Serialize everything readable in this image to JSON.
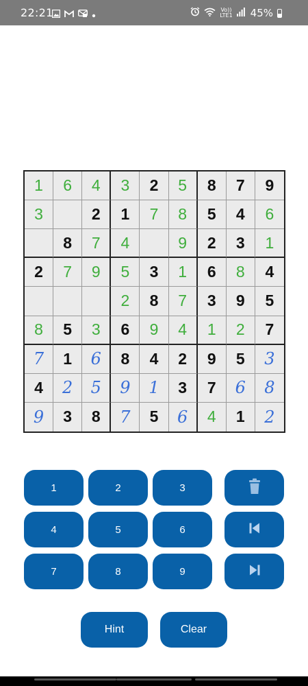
{
  "status_bar": {
    "time": "22:21",
    "battery": "45%",
    "volte_top": "Vo))",
    "volte_bottom": "LTE1",
    "notification_icons": [
      "gallery-icon",
      "gmail-icon",
      "message-icon",
      "dot-icon"
    ],
    "system_icons": [
      "alarm-icon",
      "wifi-icon",
      "volte-icon",
      "signal-icon",
      "battery-icon"
    ]
  },
  "board": {
    "rows": [
      [
        {
          "v": "1",
          "t": "solved"
        },
        {
          "v": "6",
          "t": "solved"
        },
        {
          "v": "4",
          "t": "solved"
        },
        {
          "v": "3",
          "t": "solved"
        },
        {
          "v": "2",
          "t": "given"
        },
        {
          "v": "5",
          "t": "solved"
        },
        {
          "v": "8",
          "t": "given"
        },
        {
          "v": "7",
          "t": "given"
        },
        {
          "v": "9",
          "t": "given"
        }
      ],
      [
        {
          "v": "3",
          "t": "solved"
        },
        {
          "v": "",
          "t": "empty"
        },
        {
          "v": "2",
          "t": "given"
        },
        {
          "v": "1",
          "t": "given"
        },
        {
          "v": "7",
          "t": "solved"
        },
        {
          "v": "8",
          "t": "solved"
        },
        {
          "v": "5",
          "t": "given"
        },
        {
          "v": "4",
          "t": "given"
        },
        {
          "v": "6",
          "t": "solved"
        }
      ],
      [
        {
          "v": "",
          "t": "empty"
        },
        {
          "v": "8",
          "t": "given"
        },
        {
          "v": "7",
          "t": "solved"
        },
        {
          "v": "4",
          "t": "solved"
        },
        {
          "v": "",
          "t": "empty"
        },
        {
          "v": "9",
          "t": "solved"
        },
        {
          "v": "2",
          "t": "given"
        },
        {
          "v": "3",
          "t": "given"
        },
        {
          "v": "1",
          "t": "solved"
        }
      ],
      [
        {
          "v": "2",
          "t": "given"
        },
        {
          "v": "7",
          "t": "solved"
        },
        {
          "v": "9",
          "t": "solved"
        },
        {
          "v": "5",
          "t": "solved"
        },
        {
          "v": "3",
          "t": "given"
        },
        {
          "v": "1",
          "t": "solved"
        },
        {
          "v": "6",
          "t": "given"
        },
        {
          "v": "8",
          "t": "solved"
        },
        {
          "v": "4",
          "t": "given"
        }
      ],
      [
        {
          "v": "",
          "t": "empty"
        },
        {
          "v": "",
          "t": "empty"
        },
        {
          "v": "",
          "t": "empty"
        },
        {
          "v": "2",
          "t": "solved"
        },
        {
          "v": "8",
          "t": "given"
        },
        {
          "v": "7",
          "t": "solved"
        },
        {
          "v": "3",
          "t": "given"
        },
        {
          "v": "9",
          "t": "given"
        },
        {
          "v": "5",
          "t": "given"
        }
      ],
      [
        {
          "v": "8",
          "t": "solved"
        },
        {
          "v": "5",
          "t": "given"
        },
        {
          "v": "3",
          "t": "solved"
        },
        {
          "v": "6",
          "t": "given"
        },
        {
          "v": "9",
          "t": "solved"
        },
        {
          "v": "4",
          "t": "solved"
        },
        {
          "v": "1",
          "t": "solved"
        },
        {
          "v": "2",
          "t": "solved"
        },
        {
          "v": "7",
          "t": "given"
        }
      ],
      [
        {
          "v": "7",
          "t": "pencil"
        },
        {
          "v": "1",
          "t": "given"
        },
        {
          "v": "6",
          "t": "pencil"
        },
        {
          "v": "8",
          "t": "given"
        },
        {
          "v": "4",
          "t": "given"
        },
        {
          "v": "2",
          "t": "given"
        },
        {
          "v": "9",
          "t": "given"
        },
        {
          "v": "5",
          "t": "given"
        },
        {
          "v": "3",
          "t": "pencil"
        }
      ],
      [
        {
          "v": "4",
          "t": "given"
        },
        {
          "v": "2",
          "t": "pencil"
        },
        {
          "v": "5",
          "t": "pencil"
        },
        {
          "v": "9",
          "t": "pencil"
        },
        {
          "v": "1",
          "t": "pencil"
        },
        {
          "v": "3",
          "t": "given"
        },
        {
          "v": "7",
          "t": "given"
        },
        {
          "v": "6",
          "t": "pencil"
        },
        {
          "v": "8",
          "t": "pencil"
        }
      ],
      [
        {
          "v": "9",
          "t": "pencil"
        },
        {
          "v": "3",
          "t": "given"
        },
        {
          "v": "8",
          "t": "given"
        },
        {
          "v": "7",
          "t": "pencil"
        },
        {
          "v": "5",
          "t": "given"
        },
        {
          "v": "6",
          "t": "pencil"
        },
        {
          "v": "4",
          "t": "solved"
        },
        {
          "v": "1",
          "t": "given"
        },
        {
          "v": "2",
          "t": "pencil"
        }
      ]
    ]
  },
  "keypad": {
    "numbers": [
      "1",
      "2",
      "3",
      "4",
      "5",
      "6",
      "7",
      "8",
      "9"
    ],
    "actions": {
      "delete_icon": "trash-icon",
      "undo_icon": "skip-back-icon",
      "redo_icon": "skip-forward-icon"
    },
    "hint_label": "Hint",
    "clear_label": "Clear"
  },
  "colors": {
    "button": "#0961a8",
    "given_digit": "#111111",
    "solved_digit": "#3fae3c",
    "pencil_digit": "#3a6fd8",
    "cell_bg": "#ebebeb",
    "status_bar": "#7b7b7b"
  }
}
